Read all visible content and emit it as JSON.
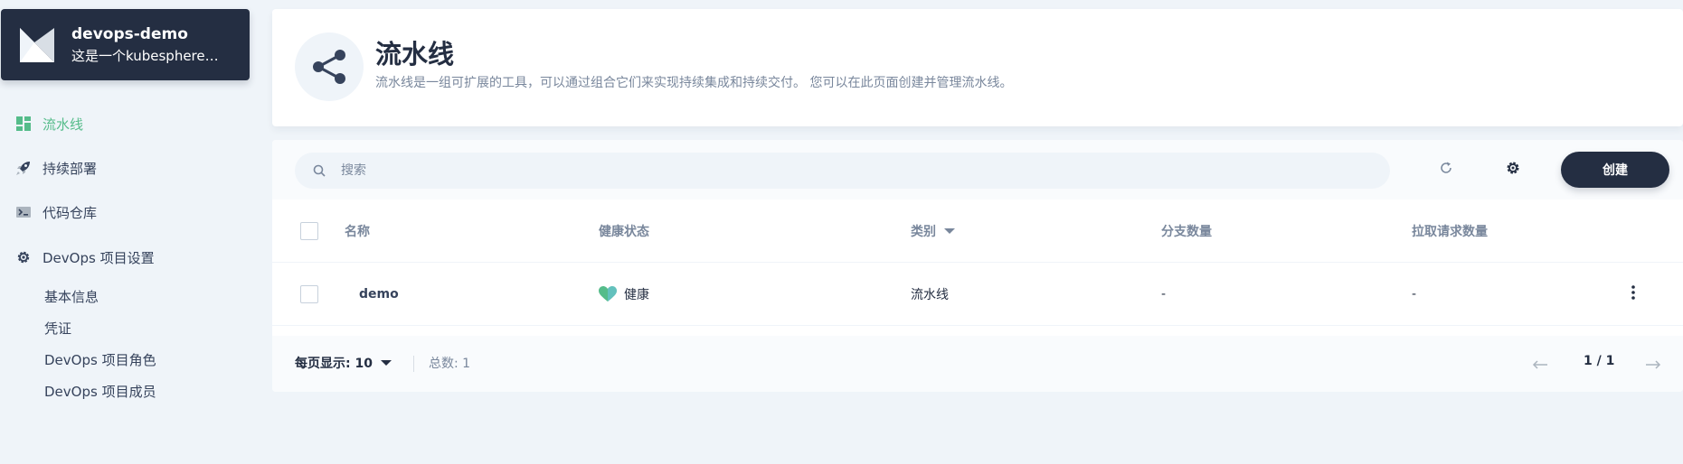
{
  "project": {
    "name": "devops-demo",
    "description": "这是一个kubesphere智..."
  },
  "sidebar": {
    "items": [
      {
        "label": "流水线",
        "icon": "pipeline-grid-icon",
        "active": true
      },
      {
        "label": "持续部署",
        "icon": "rocket-icon",
        "active": false
      },
      {
        "label": "代码仓库",
        "icon": "terminal-icon",
        "active": false
      },
      {
        "label": "DevOps 项目设置",
        "icon": "gear-icon",
        "active": false
      }
    ],
    "sub_items": [
      {
        "label": "基本信息"
      },
      {
        "label": "凭证"
      },
      {
        "label": "DevOps 项目角色"
      },
      {
        "label": "DevOps 项目成员"
      }
    ]
  },
  "banner": {
    "title": "流水线",
    "description": "流水线是一组可扩展的工具，可以通过组合它们来实现持续集成和持续交付。 您可以在此页面创建并管理流水线。",
    "icon": "share-nodes-icon"
  },
  "toolbar": {
    "search_placeholder": "搜索",
    "create_label": "创建"
  },
  "table": {
    "headers": {
      "name": "名称",
      "health": "健康状态",
      "type": "类别",
      "branches": "分支数量",
      "pull_requests": "拉取请求数量"
    },
    "rows": [
      {
        "name": "demo",
        "health": "健康",
        "type": "流水线",
        "branches": "-",
        "pull_requests": "-"
      }
    ]
  },
  "pagination": {
    "page_size_label": "每页显示: 10",
    "total_label": "总数: 1",
    "page_indicator": "1 / 1"
  },
  "colors": {
    "accent": "#55bc8a",
    "dark": "#242e42",
    "muted": "#79879c",
    "background": "#eff4f9"
  }
}
